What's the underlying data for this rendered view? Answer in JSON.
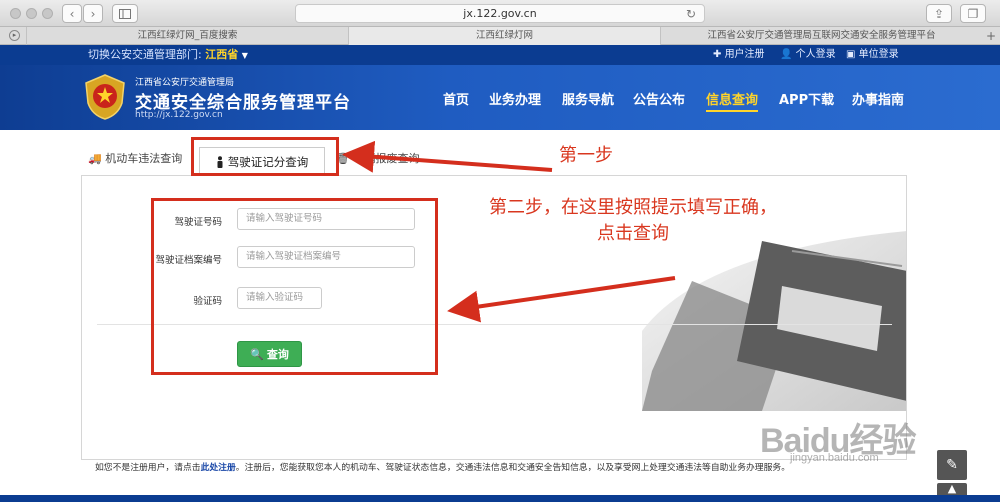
{
  "browser": {
    "url": "jx.122.gov.cn",
    "tabs": [
      "江西红绿灯网_百度搜索",
      "江西红绿灯网",
      "江西省公安厅交通管理局互联网交通安全服务管理平台"
    ]
  },
  "topbar": {
    "region_label": "切换公安交通管理部门:",
    "region_value": "江西省",
    "links": [
      "用户注册",
      "个人登录",
      "单位登录"
    ]
  },
  "header": {
    "org": "江西省公安厅交通管理局",
    "platform": "交通安全综合服务管理平台",
    "url": "http://jx.122.gov.cn",
    "nav": [
      "首页",
      "业务办理",
      "服务导航",
      "公告公布",
      "信息查询",
      "APP下载",
      "办事指南"
    ],
    "active_nav": "信息查询"
  },
  "query_tabs": [
    "机动车违法查询",
    "驾驶证记分查询",
    "车辆报废查询"
  ],
  "form": {
    "license_label": "驾驶证号码",
    "license_placeholder": "请输入驾驶证号码",
    "file_label": "驾驶证档案编号",
    "file_placeholder": "请输入驾驶证档案编号",
    "captcha_label": "验证码",
    "captcha_placeholder": "请输入验证码",
    "submit": "查询"
  },
  "footnote": {
    "prefix": "如您不是注册用户，请点击",
    "link": "此处注册",
    "suffix": "。注册后，您能获取您本人的机动车、驾驶证状态信息，交通违法信息和交通安全告知信息，以及享受网上处理交通违法等自助业务办理服务。"
  },
  "annotations": {
    "step1": "第一步",
    "step2": "第二步，在这里按照提示填写正确，点击查询",
    "color": "#d42e1d"
  },
  "watermark": {
    "brand": "Baidu经验",
    "url": "jingyan.baidu.com"
  },
  "colors": {
    "header_blue": "#1f5cc1",
    "accent_yellow": "#ffd42a",
    "submit_green": "#3eae55"
  }
}
